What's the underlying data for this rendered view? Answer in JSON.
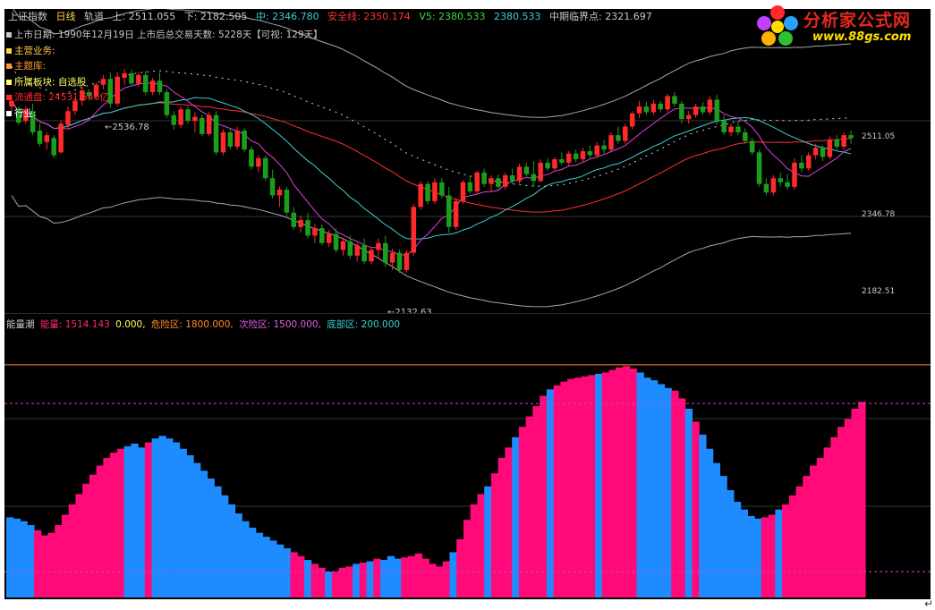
{
  "header": {
    "index_name": "上证指数",
    "period": "日线",
    "indicator": "轨道",
    "upper_label": "上: 2511.055",
    "lower_label": "下: 2182.505",
    "mid_label": "中: 2346.780",
    "safe_label": "安全线: 2350.174",
    "v5_label": "V5: 2380.533",
    "v5b_label": "2380.533",
    "mid_critical_label": "中期临界点: 2321.697"
  },
  "info_lines": [
    {
      "text": "上市日期: 1990年12月19日 上市后总交易天数: 5228天【可视: 129天】",
      "color": "#c8c8c8",
      "sq": "#c8c8c8"
    },
    {
      "text": "主营业务:",
      "color": "#ffd24a",
      "sq": "#ffd24a"
    },
    {
      "text": "主题库:",
      "color": "#ff9a2e",
      "sq": "#ff9a2e"
    },
    {
      "text": "所属板块:   自选股",
      "color": "#ffff66",
      "sq": "#ffff66"
    },
    {
      "text": "流通盘: 24531.546亿",
      "color": "#ff2a2a",
      "sq": "#ff2a2a"
    },
    {
      "text": "行业:",
      "color": "#ffffff",
      "sq": "#ffffff"
    }
  ],
  "lower_header": {
    "name": "能量潮",
    "energy": "能量: 1514.143",
    "zero": "0.000,",
    "danger": "危险区: 1800.000,",
    "sub_danger": "次险区: 1500.000,",
    "bottom": "底部区: 200.000"
  },
  "logo": {
    "title": "分析家公式网",
    "url": "www.88gs.com"
  },
  "colors": {
    "up": "#ff2a2a",
    "down": "#1c9e1c",
    "upper_band": "#a8a8a8",
    "lower_band": "#a8a8a8",
    "mid_band": "#ff3030",
    "cyan_ma": "#3cd0d0",
    "magenta_ma": "#e040e0",
    "energy_up": "#ff0a78",
    "energy_down": "#1e8cff",
    "danger_line": "#ff8c28",
    "sub_danger_line": "#d040d0"
  },
  "chart_data": [
    {
      "type": "candlestick",
      "title": "上证指数 日线",
      "y_labels": [
        "2511.05",
        "2346.78",
        "2182.51"
      ],
      "annotations": [
        "2536.78",
        "2132.63"
      ],
      "ylim": [
        2110,
        2640
      ],
      "candles": [
        [
          2470,
          2490,
          2462,
          2480
        ],
        [
          2465,
          2470,
          2438,
          2442
        ],
        [
          2445,
          2470,
          2440,
          2465
        ],
        [
          2460,
          2475,
          2420,
          2425
        ],
        [
          2428,
          2440,
          2400,
          2405
        ],
        [
          2408,
          2425,
          2395,
          2420
        ],
        [
          2415,
          2420,
          2380,
          2385
        ],
        [
          2390,
          2445,
          2388,
          2440
        ],
        [
          2438,
          2470,
          2430,
          2462
        ],
        [
          2462,
          2485,
          2455,
          2480
        ],
        [
          2480,
          2505,
          2472,
          2498
        ],
        [
          2495,
          2500,
          2480,
          2488
        ],
        [
          2488,
          2512,
          2484,
          2508
        ],
        [
          2508,
          2525,
          2500,
          2518
        ],
        [
          2518,
          2530,
          2468,
          2475
        ],
        [
          2475,
          2530,
          2470,
          2522
        ],
        [
          2520,
          2536,
          2508,
          2528
        ],
        [
          2528,
          2534,
          2505,
          2510
        ],
        [
          2510,
          2530,
          2505,
          2525
        ],
        [
          2525,
          2532,
          2490,
          2495
        ],
        [
          2495,
          2520,
          2490,
          2515
        ],
        [
          2515,
          2530,
          2490,
          2495
        ],
        [
          2495,
          2500,
          2450,
          2455
        ],
        [
          2455,
          2462,
          2430,
          2438
        ],
        [
          2438,
          2470,
          2432,
          2465
        ],
        [
          2465,
          2470,
          2440,
          2445
        ],
        [
          2445,
          2460,
          2425,
          2452
        ],
        [
          2450,
          2456,
          2418,
          2422
        ],
        [
          2422,
          2460,
          2418,
          2455
        ],
        [
          2455,
          2462,
          2385,
          2390
        ],
        [
          2390,
          2430,
          2385,
          2425
        ],
        [
          2425,
          2430,
          2395,
          2400
        ],
        [
          2400,
          2435,
          2395,
          2428
        ],
        [
          2428,
          2432,
          2390,
          2395
        ],
        [
          2395,
          2400,
          2360,
          2365
        ],
        [
          2365,
          2385,
          2355,
          2380
        ],
        [
          2380,
          2385,
          2340,
          2345
        ],
        [
          2345,
          2360,
          2310,
          2315
        ],
        [
          2315,
          2330,
          2295,
          2325
        ],
        [
          2325,
          2330,
          2280,
          2285
        ],
        [
          2285,
          2295,
          2255,
          2260
        ],
        [
          2260,
          2280,
          2250,
          2272
        ],
        [
          2272,
          2285,
          2240,
          2245
        ],
        [
          2245,
          2265,
          2232,
          2258
        ],
        [
          2258,
          2265,
          2228,
          2232
        ],
        [
          2232,
          2255,
          2225,
          2248
        ],
        [
          2248,
          2258,
          2215,
          2220
        ],
        [
          2220,
          2240,
          2210,
          2235
        ],
        [
          2235,
          2245,
          2205,
          2210
        ],
        [
          2210,
          2232,
          2200,
          2228
        ],
        [
          2228,
          2240,
          2195,
          2200
        ],
        [
          2200,
          2225,
          2195,
          2220
        ],
        [
          2220,
          2240,
          2205,
          2232
        ],
        [
          2232,
          2245,
          2190,
          2198
        ],
        [
          2198,
          2222,
          2185,
          2215
        ],
        [
          2215,
          2220,
          2180,
          2185
        ],
        [
          2185,
          2220,
          2180,
          2215
        ],
        [
          2215,
          2300,
          2210,
          2295
        ],
        [
          2295,
          2340,
          2290,
          2335
        ],
        [
          2335,
          2340,
          2300,
          2305
        ],
        [
          2305,
          2345,
          2300,
          2338
        ],
        [
          2338,
          2345,
          2310,
          2315
        ],
        [
          2315,
          2330,
          2250,
          2260
        ],
        [
          2260,
          2310,
          2255,
          2305
        ],
        [
          2305,
          2342,
          2300,
          2338
        ],
        [
          2338,
          2350,
          2318,
          2322
        ],
        [
          2322,
          2358,
          2318,
          2355
        ],
        [
          2355,
          2362,
          2330,
          2335
        ],
        [
          2335,
          2350,
          2320,
          2345
        ],
        [
          2345,
          2352,
          2325,
          2330
        ],
        [
          2330,
          2355,
          2325,
          2350
        ],
        [
          2350,
          2362,
          2335,
          2340
        ],
        [
          2340,
          2370,
          2335,
          2365
        ],
        [
          2365,
          2372,
          2348,
          2352
        ],
        [
          2352,
          2375,
          2330,
          2340
        ],
        [
          2340,
          2378,
          2338,
          2372
        ],
        [
          2372,
          2380,
          2358,
          2362
        ],
        [
          2362,
          2382,
          2358,
          2378
        ],
        [
          2378,
          2390,
          2368,
          2372
        ],
        [
          2372,
          2392,
          2365,
          2388
        ],
        [
          2388,
          2395,
          2372,
          2378
        ],
        [
          2378,
          2398,
          2372,
          2392
        ],
        [
          2392,
          2402,
          2380,
          2385
        ],
        [
          2385,
          2408,
          2380,
          2402
        ],
        [
          2402,
          2412,
          2388,
          2395
        ],
        [
          2395,
          2425,
          2390,
          2420
        ],
        [
          2420,
          2435,
          2405,
          2410
        ],
        [
          2410,
          2440,
          2405,
          2435
        ],
        [
          2435,
          2462,
          2430,
          2458
        ],
        [
          2458,
          2480,
          2450,
          2470
        ],
        [
          2470,
          2478,
          2455,
          2460
        ],
        [
          2460,
          2482,
          2455,
          2475
        ],
        [
          2475,
          2480,
          2460,
          2465
        ],
        [
          2465,
          2492,
          2460,
          2488
        ],
        [
          2488,
          2495,
          2470,
          2475
        ],
        [
          2475,
          2480,
          2440,
          2448
        ],
        [
          2448,
          2462,
          2440,
          2455
        ],
        [
          2455,
          2475,
          2450,
          2470
        ],
        [
          2470,
          2478,
          2455,
          2460
        ],
        [
          2460,
          2488,
          2455,
          2482
        ],
        [
          2482,
          2490,
          2438,
          2445
        ],
        [
          2445,
          2455,
          2420,
          2425
        ],
        [
          2425,
          2440,
          2418,
          2435
        ],
        [
          2435,
          2445,
          2420,
          2425
        ],
        [
          2425,
          2432,
          2405,
          2410
        ],
        [
          2410,
          2415,
          2385,
          2390
        ],
        [
          2390,
          2395,
          2330,
          2335
        ],
        [
          2335,
          2345,
          2315,
          2320
        ],
        [
          2320,
          2350,
          2315,
          2345
        ],
        [
          2345,
          2355,
          2330,
          2338
        ],
        [
          2338,
          2352,
          2325,
          2330
        ],
        [
          2330,
          2380,
          2325,
          2372
        ],
        [
          2372,
          2385,
          2355,
          2362
        ],
        [
          2362,
          2390,
          2358,
          2385
        ],
        [
          2385,
          2405,
          2378,
          2398
        ],
        [
          2398,
          2402,
          2375,
          2382
        ],
        [
          2382,
          2418,
          2378,
          2412
        ],
        [
          2412,
          2420,
          2395,
          2400
        ],
        [
          2400,
          2425,
          2395,
          2420
        ],
        [
          2420,
          2428,
          2405,
          2415
        ]
      ]
    },
    {
      "type": "area",
      "title": "能量潮",
      "ylim": [
        0,
        2200
      ],
      "reference_lines": [
        {
          "name": "危险区",
          "value": 1800
        },
        {
          "name": "次险区",
          "value": 1500
        },
        {
          "name": "底部区",
          "value": 200
        }
      ],
      "values": [
        620,
        610,
        590,
        560,
        520,
        480,
        500,
        560,
        640,
        720,
        800,
        880,
        950,
        1020,
        1080,
        1120,
        1150,
        1170,
        1190,
        1160,
        1200,
        1230,
        1250,
        1230,
        1200,
        1150,
        1100,
        1040,
        980,
        920,
        860,
        790,
        720,
        650,
        590,
        540,
        500,
        470,
        440,
        410,
        380,
        350,
        320,
        290,
        260,
        230,
        200,
        200,
        230,
        240,
        260,
        270,
        280,
        300,
        290,
        320,
        300,
        310,
        320,
        340,
        300,
        260,
        240,
        280,
        350,
        450,
        600,
        720,
        800,
        860,
        960,
        1080,
        1160,
        1240,
        1320,
        1400,
        1480,
        1560,
        1610,
        1640,
        1670,
        1690,
        1700,
        1710,
        1720,
        1730,
        1740,
        1760,
        1780,
        1790,
        1770,
        1740,
        1700,
        1680,
        1650,
        1620,
        1600,
        1540,
        1460,
        1360,
        1260,
        1150,
        1040,
        940,
        830,
        740,
        680,
        630,
        610,
        620,
        640,
        680,
        720,
        790,
        860,
        940,
        1020,
        1080,
        1160,
        1240,
        1320,
        1380,
        1460,
        1514
      ],
      "up_flags": [
        0,
        0,
        0,
        0,
        1,
        1,
        1,
        1,
        1,
        1,
        1,
        1,
        1,
        1,
        1,
        1,
        1,
        0,
        0,
        0,
        1,
        0,
        0,
        0,
        0,
        0,
        0,
        0,
        0,
        0,
        0,
        0,
        0,
        0,
        0,
        0,
        0,
        0,
        0,
        0,
        0,
        1,
        1,
        0,
        1,
        1,
        0,
        1,
        1,
        1,
        0,
        1,
        0,
        1,
        0,
        0,
        0,
        1,
        1,
        1,
        1,
        1,
        1,
        1,
        0,
        1,
        1,
        1,
        1,
        0,
        1,
        1,
        1,
        0,
        1,
        1,
        1,
        1,
        0,
        1,
        1,
        1,
        1,
        1,
        1,
        0,
        1,
        1,
        1,
        1,
        1,
        0,
        0,
        0,
        0,
        0,
        1,
        1,
        0,
        1,
        0,
        0,
        0,
        0,
        0,
        0,
        0,
        0,
        0,
        1,
        1,
        0,
        1,
        1,
        1,
        1,
        1,
        1,
        1,
        1,
        1,
        1,
        1,
        1,
        1,
        1,
        1,
        1
      ]
    }
  ]
}
